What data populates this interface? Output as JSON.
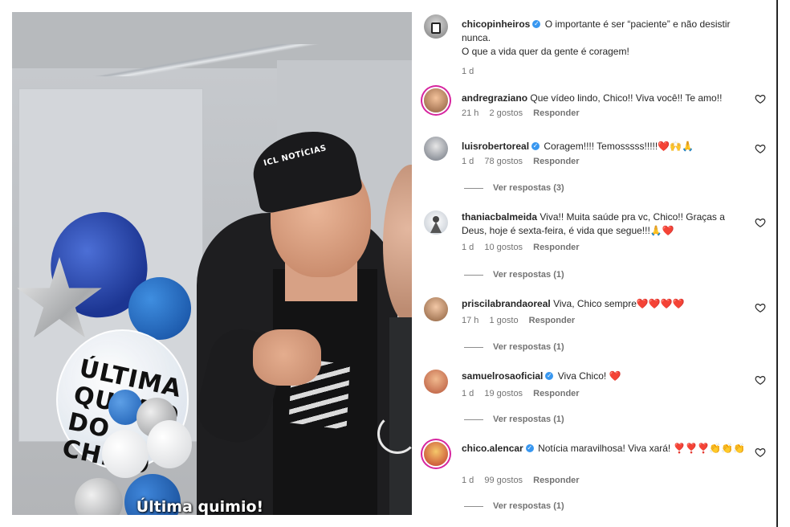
{
  "video": {
    "subtitle": "Última quimio!",
    "cap_text": "ICL NOTÍCIAS",
    "balloon_text": "ÚLTIMA QUIMIO DO CHICO"
  },
  "post": {
    "username": "chicopinheiros",
    "caption_line1": "O importante é ser “paciente” e não desistir nunca.",
    "caption_line2": "O que a vida quer da gente é coragem!",
    "time": "1 d"
  },
  "labels": {
    "reply": "Responder"
  },
  "comments": [
    {
      "username": "andregraziano",
      "verified": false,
      "text": "Que vídeo lindo, Chico!! Viva você!! Te amo!!",
      "time": "21 h",
      "likes": "2 gostos",
      "replies": ""
    },
    {
      "username": "luisrobertoreal",
      "verified": true,
      "text": "Coragem!!!! Temosssss!!!!!❤️🙌🙏",
      "time": "1 d",
      "likes": "78 gostos",
      "replies": "Ver respostas (3)"
    },
    {
      "username": "thaniacbalmeida",
      "verified": false,
      "text": "Viva!! Muita saúde pra vc, Chico!! Graças a Deus, hoje é sexta-feira, é vida que segue!!!🙏❤️",
      "time": "1 d",
      "likes": "10 gostos",
      "replies": "Ver respostas (1)"
    },
    {
      "username": "priscilabrandaoreal",
      "verified": false,
      "text": "Viva, Chico sempre❤️❤️❤️❤️",
      "time": "17 h",
      "likes": "1 gosto",
      "replies": "Ver respostas (1)"
    },
    {
      "username": "samuelrosaoficial",
      "verified": true,
      "text": "Viva Chico! ❤️",
      "time": "1 d",
      "likes": "19 gostos",
      "replies": "Ver respostas (1)"
    },
    {
      "username": "chico.alencar",
      "verified": true,
      "text": "Notícia maravilhosa! Viva xará! ❣️❣️❣️👏👏👏",
      "time": "1 d",
      "likes": "99 gostos",
      "replies": "Ver respostas (1)"
    }
  ],
  "colors": {
    "text": "#262626",
    "muted": "#737373",
    "verified": "#3897f0"
  },
  "icons": {
    "verified": "verified-badge-icon",
    "like": "heart-outline-icon"
  }
}
